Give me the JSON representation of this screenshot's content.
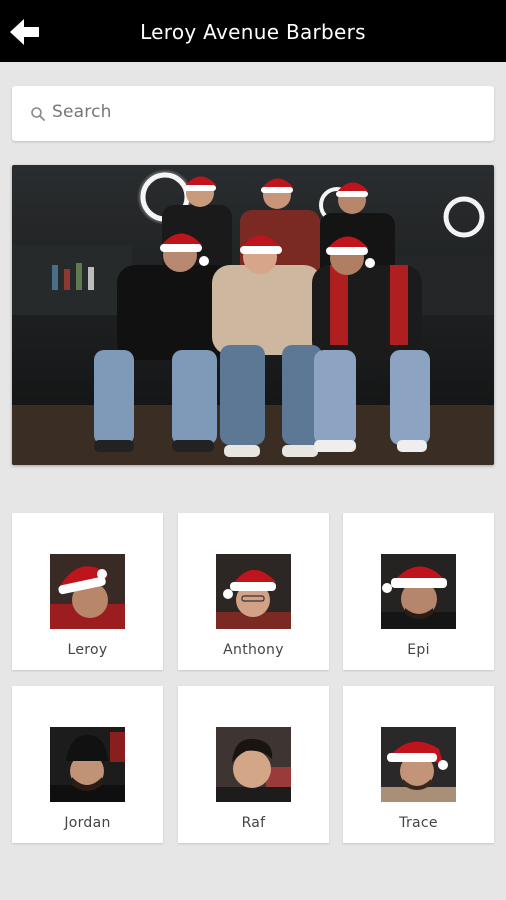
{
  "header": {
    "title": "Leroy Avenue Barbers",
    "back_icon": "arrow-left-icon"
  },
  "search": {
    "placeholder": "Search",
    "icon": "search-icon"
  },
  "hero": {
    "alt": "group photo of barbers in santa hats"
  },
  "barbers": [
    {
      "name": "Leroy"
    },
    {
      "name": "Anthony"
    },
    {
      "name": "Epi"
    },
    {
      "name": "Jordan"
    },
    {
      "name": "Raf"
    },
    {
      "name": "Trace"
    }
  ],
  "colors": {
    "topbar": "#000000",
    "background": "#e6e6e6",
    "card": "#ffffff",
    "hat_red": "#c0141c"
  }
}
